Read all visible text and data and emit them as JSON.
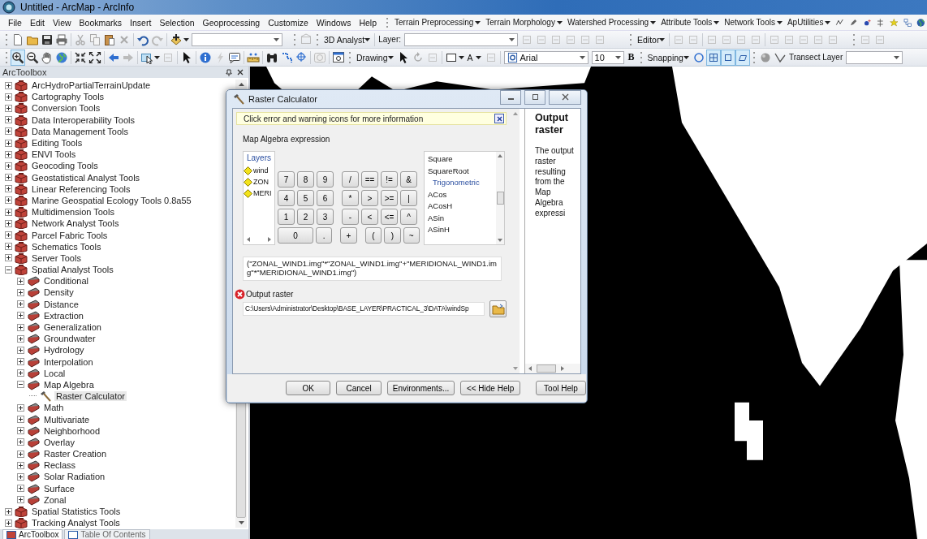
{
  "window": {
    "title": "Untitled - ArcMap - ArcInfo"
  },
  "menu_bar": {
    "menus": [
      "File",
      "Edit",
      "View",
      "Bookmarks",
      "Insert",
      "Selection",
      "Geoprocessing",
      "Customize",
      "Windows",
      "Help"
    ],
    "toolbar_menus": [
      "Terrain Preprocessing",
      "Terrain Morphology",
      "Watershed Processing",
      "Attribute Tools",
      "Network Tools",
      "ApUtilities"
    ]
  },
  "toolbars": {
    "row_1": {
      "analyst_menu": "3D Analyst",
      "layer_label": "Layer:",
      "editor_menu": "Editor"
    },
    "row_2": {
      "zoom_tool": {
        "pressed": true
      },
      "drawing_menu": "Drawing",
      "font_color": "A",
      "font": "Arial",
      "font_size": "10",
      "bold": "B",
      "snapping_menu": "Snapping",
      "snapping_toggles": [
        {
          "pressed": true
        },
        {
          "pressed": true
        },
        {
          "pressed": true
        }
      ],
      "transect_label": "Transect Layer"
    }
  },
  "toolbox": {
    "title": "ArcToolbox",
    "items": [
      {
        "label": "ArcHydroPartialTerrainUpdate",
        "kind": "toolbox",
        "expanded": false,
        "selected": false
      },
      {
        "label": "Cartography Tools",
        "kind": "toolbox",
        "expanded": false,
        "selected": false
      },
      {
        "label": "Conversion Tools",
        "kind": "toolbox",
        "expanded": false,
        "selected": false
      },
      {
        "label": "Data Interoperability Tools",
        "kind": "toolbox",
        "expanded": false,
        "selected": false
      },
      {
        "label": "Data Management Tools",
        "kind": "toolbox",
        "expanded": false,
        "selected": false
      },
      {
        "label": "Editing Tools",
        "kind": "toolbox",
        "expanded": false,
        "selected": false
      },
      {
        "label": "ENVI Tools",
        "kind": "toolbox",
        "expanded": false,
        "selected": false
      },
      {
        "label": "Geocoding Tools",
        "kind": "toolbox",
        "expanded": false,
        "selected": false
      },
      {
        "label": "Geostatistical Analyst Tools",
        "kind": "toolbox",
        "expanded": false,
        "selected": false
      },
      {
        "label": "Linear Referencing Tools",
        "kind": "toolbox",
        "expanded": false,
        "selected": false
      },
      {
        "label": "Marine Geospatial Ecology Tools 0.8a55",
        "kind": "toolbox",
        "expanded": false,
        "selected": false
      },
      {
        "label": "Multidimension Tools",
        "kind": "toolbox",
        "expanded": false,
        "selected": false
      },
      {
        "label": "Network Analyst Tools",
        "kind": "toolbox",
        "expanded": false,
        "selected": false
      },
      {
        "label": "Parcel Fabric Tools",
        "kind": "toolbox",
        "expanded": false,
        "selected": false
      },
      {
        "label": "Schematics Tools",
        "kind": "toolbox",
        "expanded": false,
        "selected": false
      },
      {
        "label": "Server Tools",
        "kind": "toolbox",
        "expanded": false,
        "selected": false
      },
      {
        "label": "Spatial Analyst Tools",
        "kind": "toolbox",
        "expanded": true,
        "selected": false,
        "children": [
          {
            "label": "Conditional",
            "kind": "toolset",
            "expanded": false,
            "selected": false
          },
          {
            "label": "Density",
            "kind": "toolset",
            "expanded": false,
            "selected": false
          },
          {
            "label": "Distance",
            "kind": "toolset",
            "expanded": false,
            "selected": false
          },
          {
            "label": "Extraction",
            "kind": "toolset",
            "expanded": false,
            "selected": false
          },
          {
            "label": "Generalization",
            "kind": "toolset",
            "expanded": false,
            "selected": false
          },
          {
            "label": "Groundwater",
            "kind": "toolset",
            "expanded": false,
            "selected": false
          },
          {
            "label": "Hydrology",
            "kind": "toolset",
            "expanded": false,
            "selected": false
          },
          {
            "label": "Interpolation",
            "kind": "toolset",
            "expanded": false,
            "selected": false
          },
          {
            "label": "Local",
            "kind": "toolset",
            "expanded": false,
            "selected": false
          },
          {
            "label": "Map Algebra",
            "kind": "toolset",
            "expanded": true,
            "selected": false,
            "children": [
              {
                "label": "Raster Calculator",
                "kind": "tool",
                "selected": true
              }
            ]
          },
          {
            "label": "Math",
            "kind": "toolset",
            "expanded": false,
            "selected": false
          },
          {
            "label": "Multivariate",
            "kind": "toolset",
            "expanded": false,
            "selected": false
          },
          {
            "label": "Neighborhood",
            "kind": "toolset",
            "expanded": false,
            "selected": false
          },
          {
            "label": "Overlay",
            "kind": "toolset",
            "expanded": false,
            "selected": false
          },
          {
            "label": "Raster Creation",
            "kind": "toolset",
            "expanded": false,
            "selected": false
          },
          {
            "label": "Reclass",
            "kind": "toolset",
            "expanded": false,
            "selected": false
          },
          {
            "label": "Solar Radiation",
            "kind": "toolset",
            "expanded": false,
            "selected": false
          },
          {
            "label": "Surface",
            "kind": "toolset",
            "expanded": false,
            "selected": false
          },
          {
            "label": "Zonal",
            "kind": "toolset",
            "expanded": false,
            "selected": false
          }
        ]
      },
      {
        "label": "Spatial Statistics Tools",
        "kind": "toolbox",
        "expanded": false,
        "selected": false
      },
      {
        "label": "Tracking Analyst Tools",
        "kind": "toolbox",
        "expanded": false,
        "selected": false
      }
    ]
  },
  "panel_tabs": [
    {
      "label": "ArcToolbox",
      "selected": true
    },
    {
      "label": "Table Of Contents",
      "selected": false
    }
  ],
  "dialog": {
    "title": "Raster Calculator",
    "message": "Click error and warning icons for more information",
    "expression_label": "Map Algebra expression",
    "layers_header": "Layers",
    "layers": [
      "wind",
      "ZON",
      "MERI"
    ],
    "key_rows": [
      [
        {
          "label": "7",
          "kind": "key"
        },
        {
          "label": "8",
          "kind": "key"
        },
        {
          "label": "9",
          "kind": "key"
        },
        {
          "label": "/",
          "kind": "key"
        },
        {
          "label": "==",
          "kind": "key"
        },
        {
          "label": "!=",
          "kind": "key"
        },
        {
          "label": "&",
          "kind": "key"
        }
      ],
      [
        {
          "label": "4",
          "kind": "key"
        },
        {
          "label": "5",
          "kind": "key"
        },
        {
          "label": "6",
          "kind": "key"
        },
        {
          "label": "*",
          "kind": "key"
        },
        {
          "label": ">",
          "kind": "key"
        },
        {
          "label": ">=",
          "kind": "key"
        },
        {
          "label": "|",
          "kind": "key"
        }
      ],
      [
        {
          "label": "1",
          "kind": "key"
        },
        {
          "label": "2",
          "kind": "key"
        },
        {
          "label": "3",
          "kind": "key"
        },
        {
          "label": "-",
          "kind": "key"
        },
        {
          "label": "<",
          "kind": "key"
        },
        {
          "label": "<=",
          "kind": "key"
        },
        {
          "label": "^",
          "kind": "key"
        }
      ],
      [
        {
          "label": "0",
          "kind": "wide"
        },
        {
          "label": ".",
          "kind": "key"
        },
        {
          "label": "+",
          "kind": "key"
        },
        {
          "label": "(",
          "kind": "key"
        },
        {
          "label": ")",
          "kind": "key"
        },
        {
          "label": "~",
          "kind": "key"
        }
      ]
    ],
    "functions": [
      {
        "label": "Square",
        "kind": "function"
      },
      {
        "label": "SquareRoot",
        "kind": "function"
      },
      {
        "label": "Trigonometric",
        "kind": "category"
      },
      {
        "label": "ACos",
        "kind": "function"
      },
      {
        "label": "ACosH",
        "kind": "function"
      },
      {
        "label": "ASin",
        "kind": "function"
      },
      {
        "label": "ASinH",
        "kind": "function"
      }
    ],
    "expression": "(\"ZONAL_WIND1.img\"*\"ZONAL_WIND1.img\"+\"MERIDIONAL_WIND1.img\"*\"MERIDIONAL_WIND1.img\")",
    "output": {
      "label": "Output raster",
      "error": true,
      "value": "C:\\Users\\Administrator\\Desktop\\BASE_LAYER\\PRACTICAL_3\\DATA\\windSp"
    },
    "buttons": [
      "OK",
      "Cancel",
      "Environments...",
      "<< Hide Help",
      "Tool Help"
    ],
    "help": {
      "title": "Output raster",
      "text": "The output raster resulting from the Map Algebra expressi"
    }
  }
}
